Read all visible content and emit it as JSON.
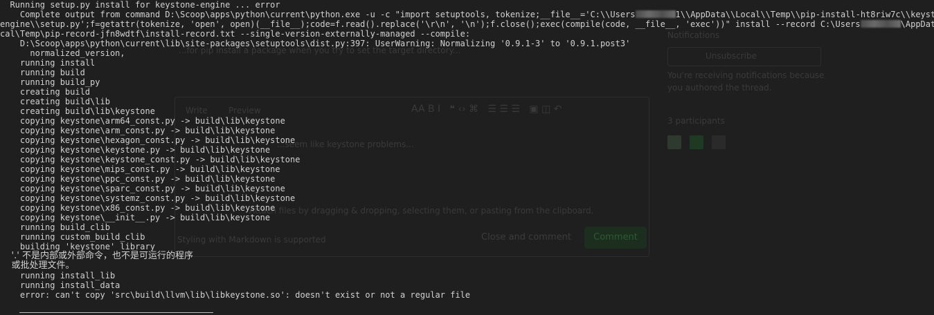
{
  "console": {
    "header": "  Running setup.py install for keystone-engine ... error",
    "cmd_1a": "    Complete output from command D:\\Scoop\\apps\\python\\current\\python.exe -u -c \"import setuptools, tokenize;__file__='C:\\\\Users",
    "cmd_1b": "1\\\\AppData\\\\Local\\\\Temp\\\\pip-install-ht8riw7c\\\\keystone-",
    "cmd_2": "engine\\\\setup.py';f=getattr(tokenize, 'open', open)(__file__);code=f.read().replace('\\r\\n', '\\n');f.close();exec(compile(code, __file__, 'exec'))\" install --record C:\\Users",
    "cmd_2b": "\\AppData\\Lo",
    "cmd_3": "cal\\Temp\\pip-record-jfn8wdtf\\install-record.txt --single-version-externally-managed --compile:",
    "lines": [
      "    D:\\Scoop\\apps\\python\\current\\lib\\site-packages\\setuptools\\dist.py:397: UserWarning: Normalizing '0.9.1-3' to '0.9.1.post3'",
      "      normalized_version,",
      "    running install",
      "    running build",
      "    running build_py",
      "    creating build",
      "    creating build\\lib",
      "    creating build\\lib\\keystone",
      "    copying keystone\\arm64_const.py -> build\\lib\\keystone",
      "    copying keystone\\arm_const.py -> build\\lib\\keystone",
      "    copying keystone\\hexagon_const.py -> build\\lib\\keystone",
      "    copying keystone\\keystone.py -> build\\lib\\keystone",
      "    copying keystone\\keystone_const.py -> build\\lib\\keystone",
      "    copying keystone\\mips_const.py -> build\\lib\\keystone",
      "    copying keystone\\ppc_const.py -> build\\lib\\keystone",
      "    copying keystone\\sparc_const.py -> build\\lib\\keystone",
      "    copying keystone\\systemz_const.py -> build\\lib\\keystone",
      "    copying keystone\\x86_const.py -> build\\lib\\keystone",
      "    copying keystone\\__init__.py -> build\\lib\\keystone",
      "    running build_clib",
      "    running custom_build_clib",
      "    building 'keystone' library"
    ],
    "cjk_1": "    '.' 不是内部或外部命令，也不是可运行的程序",
    "cjk_2": "    或批处理文件。",
    "tail": [
      "    running install_lib",
      "    running install_data",
      "    error: can't copy 'src\\build\\llvm\\lib\\libkeystone.so': doesn't exist or not a regular file"
    ]
  },
  "background_page": {
    "notifications": "Notifications",
    "unsubscribe": "Unsubscribe",
    "receiving_1": "You're receiving notifications because",
    "receiving_2": "you authored the thread.",
    "participants": "3 participants",
    "write_tab": "Write",
    "preview_tab": "Preview",
    "comment_text": "...seem like keystone problems...",
    "attach_hint": "Attach files by dragging & dropping, selecting them, or pasting from the clipboard.",
    "markdown_hint": "Styling with Markdown is supported",
    "close_button": "Close and comment",
    "comment_button": "Comment",
    "truncated_text": "...for pip install a package when you try to set the target directory..."
  },
  "colors": {
    "console_bg": "#1f1f1f",
    "console_text": "#d2d2d2",
    "ghost_text": "#3a3a3a",
    "ghost_green": "#1f3a22"
  }
}
